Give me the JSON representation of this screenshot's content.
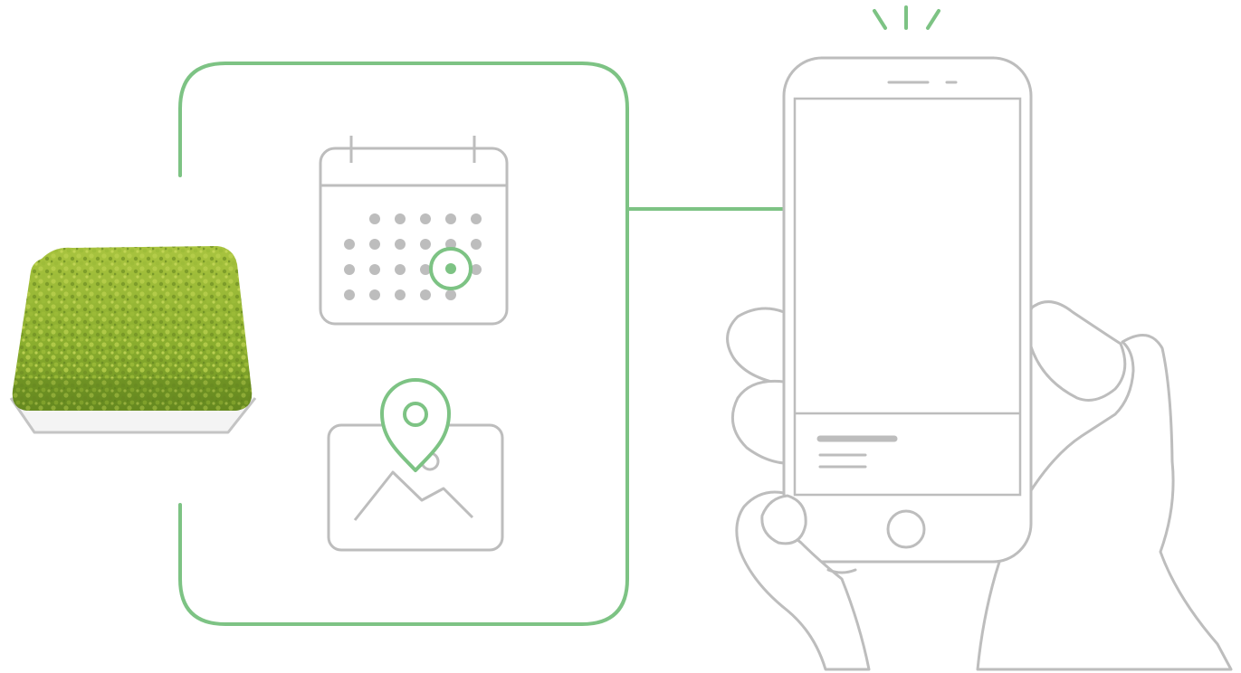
{
  "colors": {
    "accent": "#7dc384",
    "outline": "#bdbdbd",
    "moss_light": "#a6c13c",
    "moss_dark": "#5b7e1f",
    "tray": "#c8c8c8"
  },
  "illustration": {
    "product": "moss-tile",
    "panel_icons": [
      "calendar-icon",
      "location-pin-icon",
      "landscape-photo-icon"
    ],
    "device": "smartphone",
    "connector": "panel-to-phone-link",
    "notification": "phone-notification-signal-icon"
  },
  "calendar": {
    "rows": [
      [
        false,
        true,
        true,
        true,
        true,
        true
      ],
      [
        true,
        true,
        true,
        true,
        true,
        true
      ],
      [
        true,
        true,
        true,
        true,
        true,
        true
      ],
      [
        true,
        true,
        true,
        true,
        true,
        false
      ]
    ],
    "highlighted": {
      "row": 2,
      "col": 4
    }
  }
}
